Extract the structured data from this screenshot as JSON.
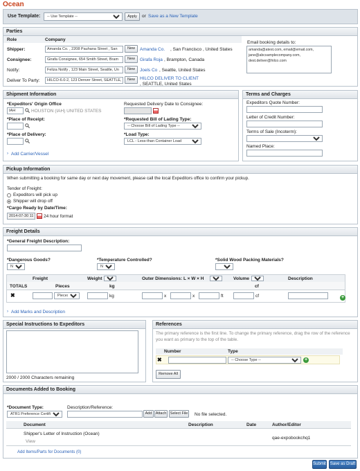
{
  "app": {
    "title": "Ocean"
  },
  "template": {
    "label": "Use Template:",
    "select_value": "-- Use Template --",
    "apply": "Apply",
    "or": "or",
    "save_link": "Save as a New Template"
  },
  "parties": {
    "title": "Parties",
    "col_role": "Role",
    "col_company": "Company",
    "new_label": "New",
    "rows": [
      {
        "role": "Shipper:",
        "value": "Amanda Co. , 2208 Pauhana Street , San",
        "link": "Amanda Co.",
        "link_rest": ", San Francisco , United States"
      },
      {
        "role": "Consignee:",
        "value": "Girafa Consignee, 654 Smith Street, Bram",
        "link": "Girafa Roja",
        "link_rest": ", Brampton, Canada"
      },
      {
        "role": "Notify:",
        "value": "Feliza Notify , 123 Main Street, Seattle, Un",
        "link": "Joels Co",
        "link_rest": ", Seattle, United States"
      },
      {
        "role": "Deliver To Party:",
        "value": "HILCO-6.0-2, 123 Denver Street, SEATTLE, U",
        "link": "HILCO DELIVER TO CLIENT",
        "link_rest": ", SEATTLE, United States"
      }
    ],
    "email_label": "Email booking details to:",
    "email_lines": [
      "amanda@atest.com, email@email.com,",
      "jane@abcsamplecompany.com,",
      "dest.deliver@hilco.com"
    ]
  },
  "shipment": {
    "title": "Shipment Information",
    "origin_label": "*Expeditors' Origin Office",
    "origin_code": "IAH",
    "origin_text": "HOUSTON (IAH) UNITED STATES",
    "receipt_label": "*Place of Receipt:",
    "delivery_label": "*Place of Delivery:",
    "carrier_link": "Add Carrier/Vessel",
    "req_date_label": "Requested Delivery Date to Consignee:",
    "bol_label": "*Requested Bill of Lading Type:",
    "bol_value": "-- Choose Bill of Lading Type --",
    "load_label": "*Load Type:",
    "load_value": "LCL - Less-than Container Load"
  },
  "terms": {
    "title": "Terms and Charges",
    "quote_label": "Expeditors Quote Number:",
    "credit_label": "Letter of Credit Number:",
    "sale_label": "Terms of Sale (Incoterm):",
    "place_label": "Named Place:"
  },
  "pickup": {
    "title": "Pickup Information",
    "notice": "When submitting a booking for same day or next day movement, please call the local Expeditors office to confirm your pickup.",
    "tender_label": "Tender of Freight:",
    "opt1": "Expeditors will pick up",
    "opt2": "Shipper will drop off",
    "ready_label": "*Cargo Ready by Date/Time:",
    "ready_value": "2014-07-30 11",
    "format": "24 hour format"
  },
  "freight": {
    "title": "Freight Details",
    "desc_label": "*General Freight Description:",
    "dg_label": "*Dangerous Goods?",
    "dg_value": "No",
    "temp_label": "*Temperature Controlled?",
    "temp_value": "No",
    "wood_label": "*Solid Wood Packing Materials?",
    "col_freight": "Freight",
    "col_weight": "Weight",
    "weight_unit": "kg",
    "col_dims": "Outer Dimensions: L × W × H",
    "dims_unit": "ft",
    "col_volume": "Volume",
    "volume_unit": "cf",
    "col_description": "Description",
    "totals_label": "TOTALS",
    "pieces_label": "Pieces",
    "totals_kg": "kg",
    "totals_cf": "cf",
    "row_pieces": "Pieces",
    "row_kg": "kg",
    "row_x1": "x",
    "row_x2": "x",
    "row_ft": "ft",
    "row_cf": "cf",
    "marks_link": "Add Marks and Description"
  },
  "special": {
    "title": "Special Instructions to Expeditors",
    "remaining": "2000 / 2000 Characters remaining"
  },
  "references": {
    "title": "References",
    "help": "The primary reference is the first line. To change the primary reference, drag the row of the reference you want as primary to the top of the table.",
    "col_number": "Number",
    "col_type": "Type",
    "type_value": "-- Choose Type --",
    "remove_all": "Remove All"
  },
  "documents": {
    "title": "Documents Added to Booking",
    "doctype_label": "*Document Type:",
    "doctype_value": "ATR1 Preference Certificat",
    "descref_label": "Description/Reference:",
    "add": "Add",
    "attach": "Attach",
    "select_file": "Select File",
    "no_file": "No file selected.",
    "col_document": "Document",
    "col_description": "Description",
    "col_date": "Date",
    "col_author": "Author/Editor",
    "doc_name": "Shipper's Letter of Instruction (Ocean)",
    "doc_view": "View",
    "doc_author": "qae-expobookchq1",
    "items_link": "Add Items/Parts for Documents (0)"
  },
  "actions": {
    "submit": "Submit",
    "draft": "Save as Draft"
  },
  "colors": {
    "title": "#c8411b",
    "link": "#2a62b8",
    "accent_button": "#2a5fa0"
  }
}
